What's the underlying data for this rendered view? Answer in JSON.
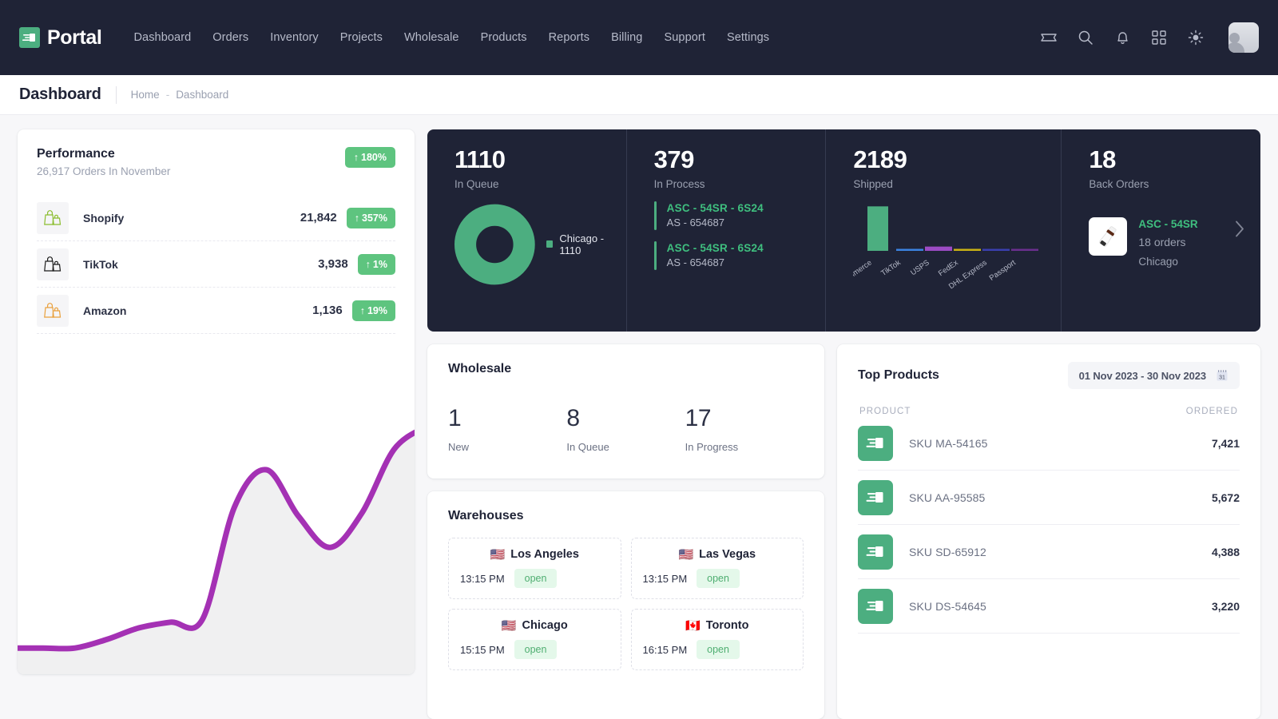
{
  "brand": {
    "name": "Portal",
    "logo_icon": "shipping-speed-icon"
  },
  "nav": {
    "links": [
      {
        "label": "Dashboard"
      },
      {
        "label": "Orders"
      },
      {
        "label": "Inventory"
      },
      {
        "label": "Projects"
      },
      {
        "label": "Wholesale"
      },
      {
        "label": "Products"
      },
      {
        "label": "Reports"
      },
      {
        "label": "Billing"
      },
      {
        "label": "Support"
      },
      {
        "label": "Settings"
      }
    ],
    "icons": [
      {
        "name": "ticket-icon"
      },
      {
        "name": "search-icon"
      },
      {
        "name": "bell-icon"
      },
      {
        "name": "apps-grid-icon"
      },
      {
        "name": "brightness-sun-icon"
      }
    ],
    "avatar": "user-avatar"
  },
  "header": {
    "title": "Dashboard",
    "breadcrumb": [
      "Home",
      "Dashboard"
    ],
    "breadcrumb_separator": "-"
  },
  "performance": {
    "title": "Performance",
    "subtitle": "26,917 Orders In November",
    "badge": "180%",
    "badge_arrow": "↑",
    "channels": [
      {
        "name": "Shopify",
        "value": "21,842",
        "change": "357%",
        "icon": "shopping-bag-icon",
        "color": "#8bbd2e"
      },
      {
        "name": "TikTok",
        "value": "3,938",
        "change": "1%",
        "icon": "shopping-bag-icon",
        "color": "#1c1c1c"
      },
      {
        "name": "Amazon",
        "value": "1,136",
        "change": "19%",
        "icon": "shopping-bag-icon",
        "color": "#e9a03c"
      }
    ]
  },
  "chart_data": [
    {
      "type": "area",
      "title": "Performance",
      "id": "performance-trend",
      "xlabel": "",
      "ylabel": "",
      "line_color": "#a431b4",
      "fill_color": "#f0f0f1",
      "x": [
        0,
        1,
        2,
        3,
        4,
        5,
        6,
        7,
        8,
        9,
        10,
        11,
        12,
        13
      ],
      "values": [
        3,
        3,
        3,
        6,
        10,
        12,
        13,
        52,
        65,
        49,
        38,
        50,
        72,
        80
      ],
      "ylim": [
        0,
        100
      ],
      "grid": false,
      "legend": "none"
    },
    {
      "type": "pie",
      "id": "in-queue-donut",
      "title": "In Queue",
      "labels": [
        "Chicago"
      ],
      "values": [
        1110
      ],
      "colors": [
        "#4cae80"
      ],
      "legend": "right",
      "legend_entries": [
        "Chicago - 1110"
      ]
    },
    {
      "type": "bar",
      "id": "shipped-carriers",
      "title": "Shipped",
      "categories": [
        "DHL eCommerce",
        "TikTok",
        "USPS",
        "FedEx",
        "DHL Express",
        "Passport"
      ],
      "values": [
        1920,
        60,
        185,
        22,
        12,
        8
      ],
      "colors": [
        "#4cae80",
        "#3b82e0",
        "#9c4bc4",
        "#c9b115",
        "#3a3fae",
        "#6a2f8e"
      ],
      "ylim": [
        0,
        2000
      ],
      "grid": false,
      "legend": "none",
      "tick_rotation": -35
    }
  ],
  "stats": {
    "in_queue": {
      "number": "1110",
      "label": "In Queue",
      "legend": [
        {
          "text": "Chicago - 1110",
          "color": "#4cae80"
        }
      ]
    },
    "in_process": {
      "number": "379",
      "label": "In Process",
      "items": [
        {
          "sku": "ASC - 54SR - 6S24",
          "ref": "AS - 654687"
        },
        {
          "sku": "ASC - 54SR - 6S24",
          "ref": "AS - 654687"
        }
      ]
    },
    "shipped": {
      "number": "2189",
      "label": "Shipped",
      "carriers": [
        "DHL eCommerce",
        "TikTok",
        "USPS",
        "FedEx",
        "DHL Express",
        "Passport"
      ]
    },
    "back_orders": {
      "number": "18",
      "label": "Back Orders",
      "item": {
        "sku": "ASC - 54SR",
        "orders": "18",
        "orders_suffix": "orders",
        "city": "Chicago",
        "thumb": "dropper-bottle-icon"
      },
      "next_icon": "chevron-right-icon"
    }
  },
  "wholesale": {
    "title": "Wholesale",
    "stats": [
      {
        "number": "1",
        "label": "New"
      },
      {
        "number": "8",
        "label": "In Queue"
      },
      {
        "number": "17",
        "label": "In Progress"
      }
    ]
  },
  "warehouses": {
    "title": "Warehouses",
    "items": [
      {
        "flag": "🇺🇸",
        "name": "Los Angeles",
        "time": "13:15 PM",
        "status": "open"
      },
      {
        "flag": "🇺🇸",
        "name": "Las Vegas",
        "time": "13:15 PM",
        "status": "open"
      },
      {
        "flag": "🇺🇸",
        "name": "Chicago",
        "time": "15:15 PM",
        "status": "open"
      },
      {
        "flag": "🇨🇦",
        "name": "Toronto",
        "time": "16:15 PM",
        "status": "open"
      }
    ]
  },
  "top_products": {
    "title": "Top Products",
    "date_range": "01 Nov 2023 - 30 Nov 2023",
    "calendar_icon": "calendar-icon",
    "columns": {
      "product": "PRODUCT",
      "ordered": "ORDERED"
    },
    "rows": [
      {
        "sku": "SKU MA-54165",
        "ordered": "7,421",
        "icon": "shipping-speed-icon"
      },
      {
        "sku": "SKU AA-95585",
        "ordered": "5,672",
        "icon": "shipping-speed-icon"
      },
      {
        "sku": "SKU SD-65912",
        "ordered": "4,388",
        "icon": "shipping-speed-icon"
      },
      {
        "sku": "SKU DS-54645",
        "ordered": "3,220",
        "icon": "shipping-speed-icon"
      }
    ]
  },
  "colors": {
    "dark_panel": "#1f2336",
    "accent_green": "#4cae80",
    "badge_green": "#5ec47f",
    "chart_purple": "#a431b4",
    "page_bg": "#f7f7f9"
  }
}
